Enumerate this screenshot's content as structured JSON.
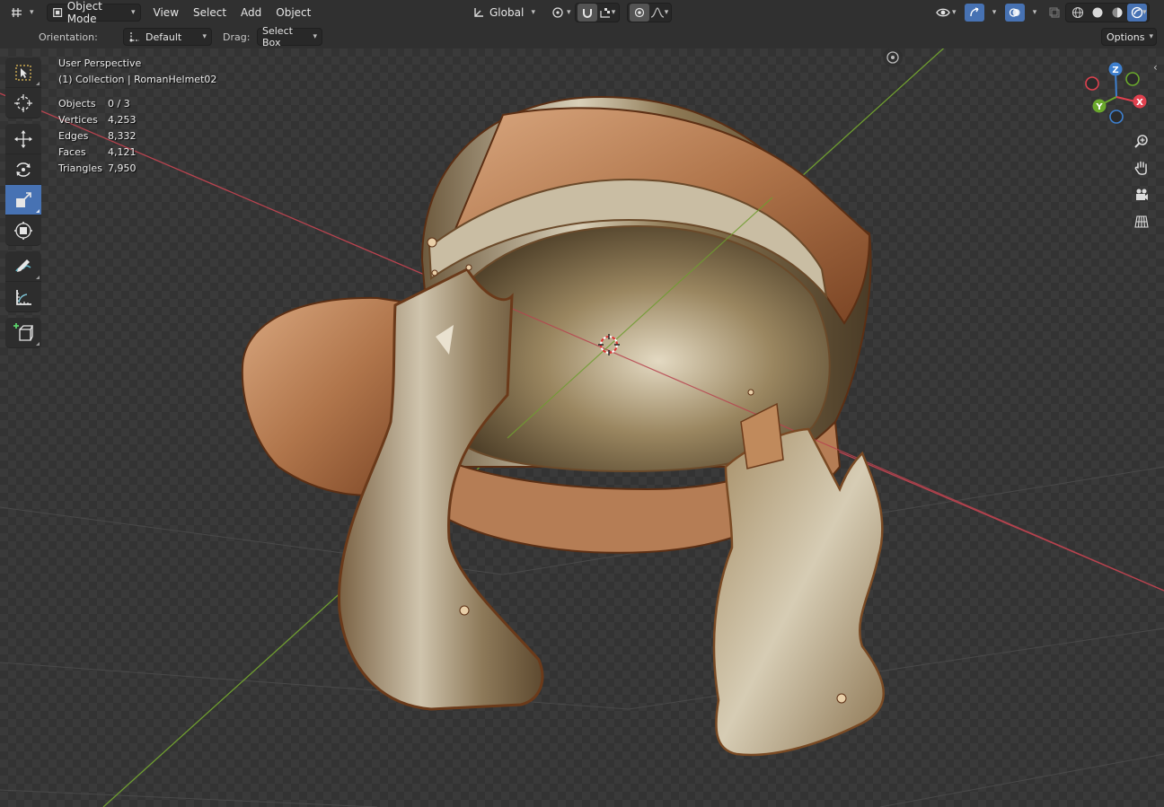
{
  "header": {
    "editor_type_icon": "viewport-grid-icon",
    "mode": "Object Mode",
    "menus": [
      "View",
      "Select",
      "Add",
      "Object"
    ],
    "transform_orientation": "Global",
    "options_label": "Options"
  },
  "tool_settings": {
    "orientation_label": "Orientation:",
    "orientation_value": "Default",
    "drag_label": "Drag:",
    "drag_value": "Select Box"
  },
  "viewport": {
    "view_name": "User Perspective",
    "collection_line": "(1) Collection | RomanHelmet02",
    "stats": [
      {
        "label": "Objects",
        "value": "0 / 3"
      },
      {
        "label": "Vertices",
        "value": "4,253"
      },
      {
        "label": "Edges",
        "value": "8,332"
      },
      {
        "label": "Faces",
        "value": "4,121"
      },
      {
        "label": "Triangles",
        "value": "7,950"
      }
    ]
  },
  "gizmo": {
    "z_label": "Z",
    "y_label": "Y",
    "x_label": "X",
    "colors": {
      "x": "#e0414f",
      "y": "#6aa82c",
      "z": "#3d7fce"
    }
  },
  "toolbar": {
    "tools": [
      "select-box-icon",
      "cursor-icon",
      "move-icon",
      "rotate-icon",
      "scale-icon",
      "transform-icon",
      "annotate-icon",
      "measure-icon",
      "add-cube-icon"
    ],
    "active": "scale-icon"
  },
  "colors": {
    "accent": "#4772b3",
    "header_bg": "#303030",
    "x_axis_line": "#b8434f",
    "y_axis_line": "#6f9d30",
    "bronze": "#b0652f"
  }
}
